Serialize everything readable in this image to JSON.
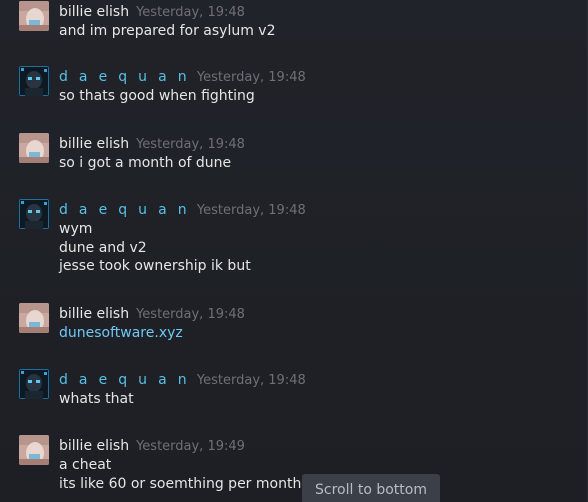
{
  "colors": {
    "background": "#1f2126",
    "name_billie": "#e8e8e8",
    "name_daequan": "#58c0e8",
    "timestamp": "#6e7076",
    "message_text": "#e6e6e6",
    "link": "#6fc8f5",
    "scroll_button_bg": "#3b3f47"
  },
  "messages": [
    {
      "author": "billie elish",
      "avatar": "billie-avatar-icon",
      "time": "Yesterday, 19:48",
      "lines": [
        "and im prepared for asylum v2"
      ]
    },
    {
      "author": "d a e q u a n",
      "avatar": "daequan-avatar-icon",
      "time": "Yesterday, 19:48",
      "lines": [
        "so thats good when fighting"
      ]
    },
    {
      "author": "billie elish",
      "avatar": "billie-avatar-icon",
      "time": "Yesterday, 19:48",
      "lines": [
        "so i got a month of dune"
      ]
    },
    {
      "author": "d a e q u a n",
      "avatar": "daequan-avatar-icon",
      "time": "Yesterday, 19:48",
      "lines": [
        "wym",
        "dune and v2",
        "jesse took ownership ik but"
      ]
    },
    {
      "author": "billie elish",
      "avatar": "billie-avatar-icon",
      "time": "Yesterday, 19:48",
      "lines": [
        "dunesoftware.xyz"
      ]
    },
    {
      "author": "d a e q u a n",
      "avatar": "daequan-avatar-icon",
      "time": "Yesterday, 19:48",
      "lines": [
        "whats that"
      ]
    },
    {
      "author": "billie elish",
      "avatar": "billie-avatar-icon",
      "time": "Yesterday, 19:49",
      "lines": [
        "a cheat",
        "its like 60 or soemthing per month"
      ]
    }
  ],
  "scroll_button": {
    "label": "Scroll to bottom"
  }
}
